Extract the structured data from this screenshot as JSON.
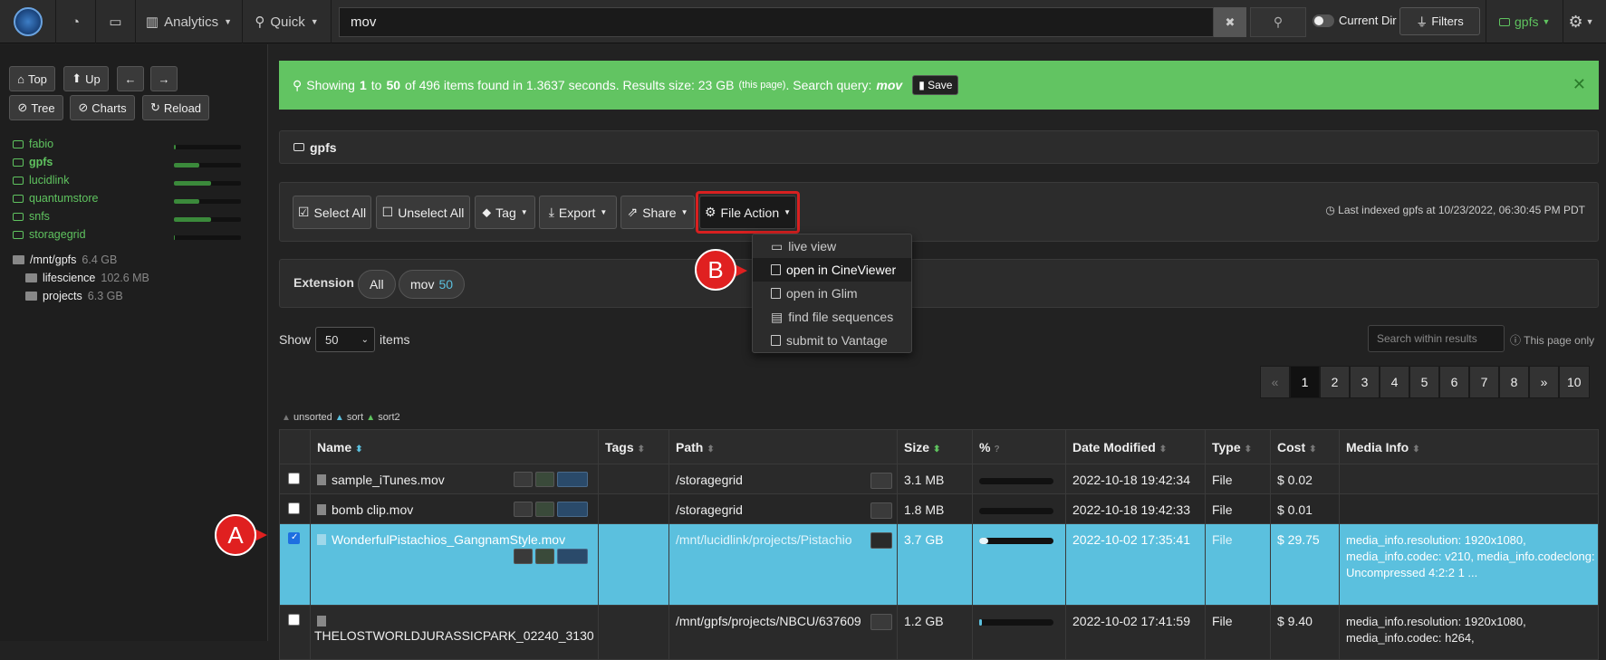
{
  "topbar": {
    "analytics_label": "Analytics",
    "quick_label": "Quick",
    "search_value": "mov",
    "current_dir_label": "Current Dir",
    "filters_label": "Filters",
    "storage_label": "gpfs"
  },
  "sidebar": {
    "buttons": {
      "top": "Top",
      "up": "Up",
      "tree": "Tree",
      "charts": "Charts",
      "reload": "Reload"
    },
    "storages": [
      {
        "name": "fabio",
        "usage": 0.03
      },
      {
        "name": "gpfs",
        "usage": 0.38
      },
      {
        "name": "lucidlink",
        "usage": 0.55
      },
      {
        "name": "quantumstore",
        "usage": 0.38
      },
      {
        "name": "snfs",
        "usage": 0.55
      },
      {
        "name": "storagegrid",
        "usage": 0.02
      }
    ],
    "dirs": [
      {
        "name": "/mnt/gpfs",
        "size": "6.4 GB"
      },
      {
        "name": "lifescience",
        "size": "102.6 MB"
      },
      {
        "name": "projects",
        "size": "6.3 GB"
      }
    ]
  },
  "alert": {
    "prefix": "Showing",
    "from": "1",
    "to_word": "to",
    "to": "50",
    "suffix": "of 496 items found in 1.3637 seconds. Results size: 23 GB",
    "small": "(this page)",
    "query_label": ". Search query:",
    "query": "mov",
    "save_label": "Save"
  },
  "panel_title": "gpfs",
  "actions": {
    "select_all": "Select All",
    "unselect_all": "Unselect All",
    "tag": "Tag",
    "export": "Export",
    "share": "Share",
    "file_action": "File Action",
    "indexed": "Last indexed gpfs at 10/23/2022, 06:30:45 PM PDT"
  },
  "dropdown": {
    "items": [
      "live view",
      "open in CineViewer",
      "open in Glim",
      "find file sequences",
      "submit to Vantage"
    ]
  },
  "extension": {
    "label": "Extension",
    "all": "All",
    "mov": "mov",
    "mov_count": "50"
  },
  "paging": {
    "show_label": "Show",
    "show_value": "50",
    "items_label": "items",
    "search_placeholder": "Search within results",
    "page_only": "This page only",
    "pages": [
      "«",
      "1",
      "2",
      "3",
      "4",
      "5",
      "6",
      "7",
      "8",
      "»",
      "10"
    ]
  },
  "sortkey": {
    "unsorted": "unsorted",
    "sort": "sort",
    "sort2": "sort2"
  },
  "table": {
    "headers": [
      "Name",
      "Tags",
      "Path",
      "Size",
      "%",
      "Date Modified",
      "Type",
      "Cost",
      "Media Info"
    ],
    "rows": [
      {
        "name": "sample_iTunes.mov",
        "path": "/storagegrid",
        "size": "3.1 MB",
        "pct": 0.0,
        "date": "2022-10-18 19:42:34",
        "type": "File",
        "cost": "$ 0.02",
        "media": ""
      },
      {
        "name": "bomb clip.mov",
        "path": "/storagegrid",
        "size": "1.8 MB",
        "pct": 0.0,
        "date": "2022-10-18 19:42:33",
        "type": "File",
        "cost": "$ 0.01",
        "media": ""
      },
      {
        "name": "WonderfulPistachios_GangnamStyle.mov",
        "path": "/mnt/lucidlink/projects/Pistachio",
        "size": "3.7 GB",
        "pct": 0.12,
        "date": "2022-10-02 17:35:41",
        "type": "File",
        "cost": "$ 29.75",
        "media": "media_info.resolution: 1920x1080, media_info.codec: v210, media_info.codeclong: Uncompressed 4:2:2 1 ..."
      },
      {
        "name": "THELOSTWORLDJURASSICPARK_02240_3130",
        "path": "/mnt/gpfs/projects/NBCU/637609",
        "size": "1.2 GB",
        "pct": 0.04,
        "date": "2022-10-02 17:41:59",
        "type": "File",
        "cost": "$ 9.40",
        "media": "media_info.resolution: 1920x1080, media_info.codec: h264,"
      }
    ]
  },
  "markers": {
    "a": "A",
    "b": "B"
  }
}
